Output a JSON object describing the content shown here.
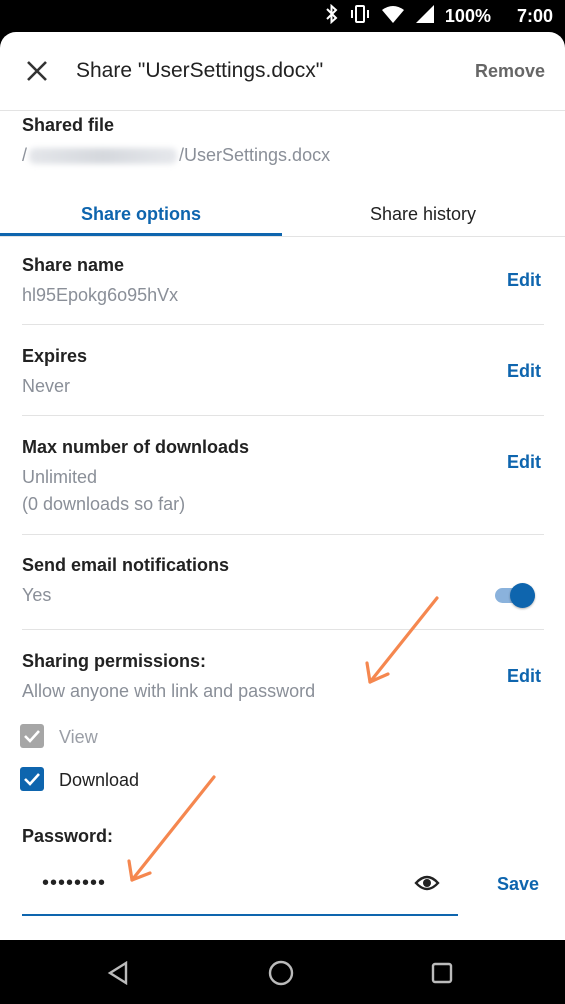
{
  "status_bar": {
    "battery": "100%",
    "time": "7:00",
    "icons": [
      "bluetooth-icon",
      "vibrate-icon",
      "wifi-icon",
      "signal-icon",
      "battery-icon"
    ]
  },
  "header": {
    "title": "Share \"UserSettings.docx\"",
    "remove_label": "Remove"
  },
  "shared_file": {
    "label": "Shared file",
    "path_prefix": "/",
    "filename": "/UserSettings.docx"
  },
  "tabs": [
    {
      "label": "Share options",
      "active": true
    },
    {
      "label": "Share history",
      "active": false
    }
  ],
  "settings": {
    "share_name": {
      "label": "Share name",
      "value": "hl95Epokg6o95hVx",
      "action": "Edit"
    },
    "expires": {
      "label": "Expires",
      "value": "Never",
      "action": "Edit"
    },
    "max_downloads": {
      "label": "Max number of downloads",
      "value": "Unlimited",
      "sub_value": "(0 downloads so far)",
      "action": "Edit"
    },
    "email_notifications": {
      "label": "Send email notifications",
      "value": "Yes",
      "enabled": true
    },
    "sharing_permissions": {
      "label": "Sharing permissions:",
      "value": "Allow anyone with link and password",
      "action": "Edit"
    }
  },
  "permissions": [
    {
      "label": "View",
      "checked": true,
      "disabled": true
    },
    {
      "label": "Download",
      "checked": true,
      "disabled": false
    }
  ],
  "password": {
    "label": "Password:",
    "value": "••••••••",
    "save_label": "Save"
  },
  "colors": {
    "accent": "#0e65ae",
    "annotation": "#f5874f",
    "muted_text": "#8a8f98"
  }
}
